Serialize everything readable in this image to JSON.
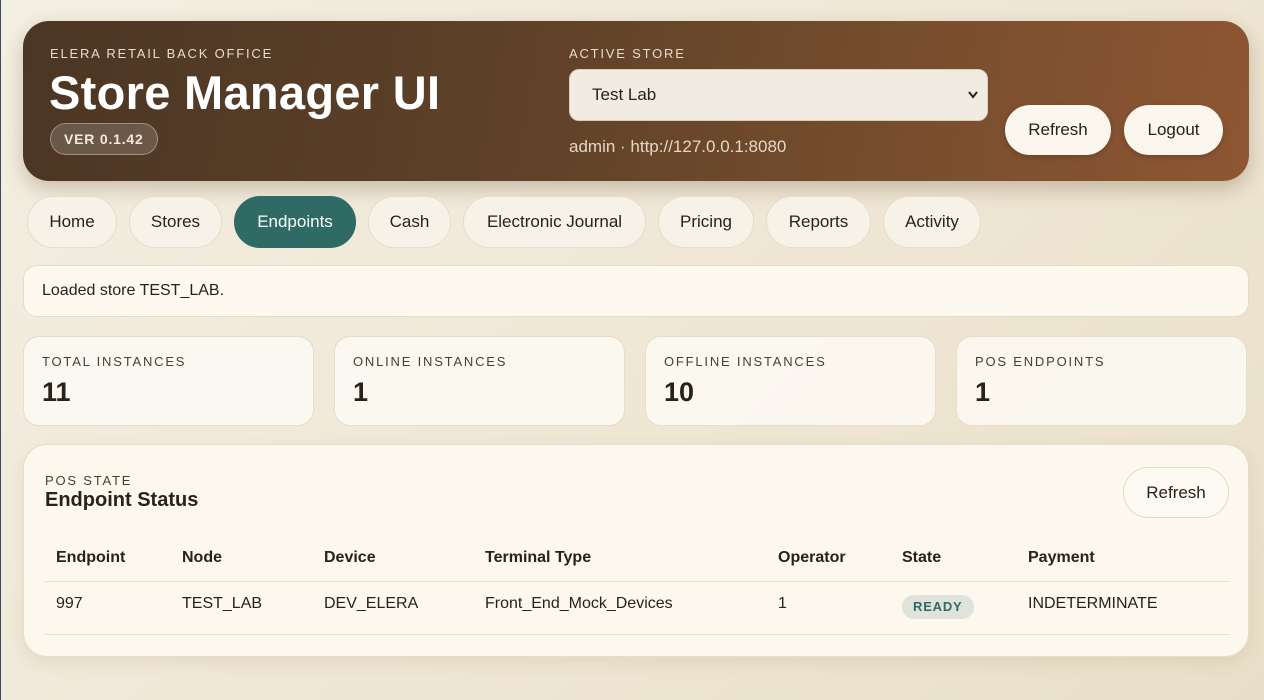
{
  "header": {
    "kicker": "ELERA RETAIL BACK OFFICE",
    "title": "Store Manager UI",
    "version": "VER 0.1.42",
    "store_kicker": "ACTIVE STORE",
    "store_selected": "Test Lab",
    "store_meta": "admin · http://127.0.0.1:8080",
    "refresh_label": "Refresh",
    "logout_label": "Logout"
  },
  "tabs": [
    {
      "label": "Home"
    },
    {
      "label": "Stores"
    },
    {
      "label": "Endpoints",
      "active": true
    },
    {
      "label": "Cash"
    },
    {
      "label": "Electronic Journal"
    },
    {
      "label": "Pricing"
    },
    {
      "label": "Reports"
    },
    {
      "label": "Activity"
    }
  ],
  "notice": "Loaded store TEST_LAB.",
  "stats": [
    {
      "label": "TOTAL INSTANCES",
      "value": "11"
    },
    {
      "label": "ONLINE INSTANCES",
      "value": "1"
    },
    {
      "label": "OFFLINE INSTANCES",
      "value": "10"
    },
    {
      "label": "POS ENDPOINTS",
      "value": "1"
    }
  ],
  "panel": {
    "kicker": "POS STATE",
    "title": "Endpoint Status",
    "refresh_label": "Refresh",
    "columns": [
      "Endpoint",
      "Node",
      "Device",
      "Terminal Type",
      "Operator",
      "State",
      "Payment"
    ],
    "rows": [
      [
        "997",
        "TEST_LAB",
        "DEV_ELERA",
        "Front_End_Mock_Devices",
        "1",
        "READY",
        "INDETERMINATE"
      ]
    ]
  },
  "colors": {
    "accent": "#2f6b64",
    "header_brown": "#5e4128",
    "background": "#f4efe3"
  }
}
